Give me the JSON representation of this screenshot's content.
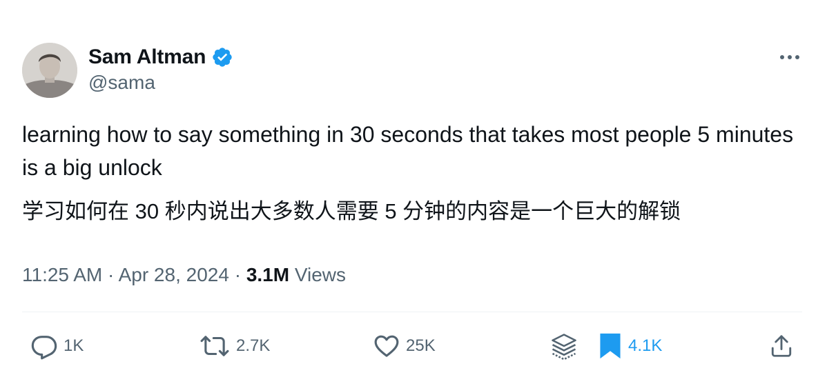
{
  "author": {
    "display_name": "Sam Altman",
    "handle": "@sama",
    "verified": true
  },
  "tweet": {
    "text_en": "learning how to say something in 30 seconds that takes most people 5 minutes is a big unlock",
    "text_zh": "学习如何在 30 秒内说出大多数人需要 5 分钟的内容是一个巨大的解锁"
  },
  "meta": {
    "time": "11:25 AM",
    "separator": "·",
    "date": "Apr 28, 2024",
    "views_count": "3.1M",
    "views_label": "Views"
  },
  "actions": {
    "replies": "1K",
    "reposts": "2.7K",
    "likes": "25K",
    "bookmarks": "4.1K"
  },
  "icons": {
    "verified": "verified-badge-icon",
    "more": "more-horizontal-icon",
    "reply": "reply-icon",
    "repost": "repost-icon",
    "like": "heart-icon",
    "grok": "layers-icon",
    "bookmark": "bookmark-icon",
    "share": "share-icon"
  },
  "colors": {
    "text_primary": "#0f1419",
    "text_secondary": "#536471",
    "accent_blue": "#1d9bf0"
  }
}
